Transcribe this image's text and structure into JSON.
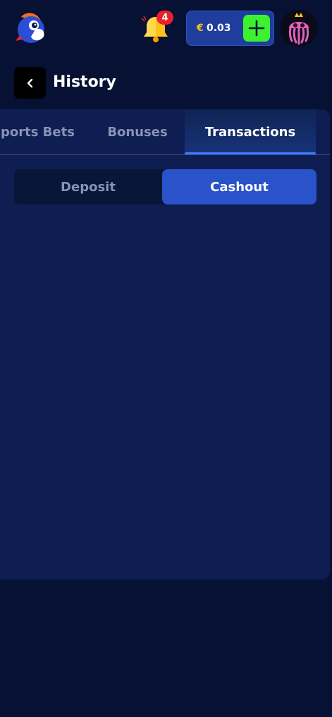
{
  "header": {
    "notification_count": "4",
    "currency_symbol": "€",
    "balance": "0.03"
  },
  "page": {
    "title": "History"
  },
  "tabs": [
    {
      "label": "Sports Bets"
    },
    {
      "label": "Bonuses"
    },
    {
      "label": "Transactions"
    }
  ],
  "active_tab": "Transactions",
  "segments": {
    "deposit": "Deposit",
    "cashout": "Cashout",
    "active": "Cashout"
  },
  "icons": {
    "logo": "bird-logo-icon",
    "bell": "bell-icon",
    "add": "plus-icon",
    "back": "chevron-left-icon",
    "avatar": "jellyfish-avatar"
  },
  "colors": {
    "background": "#061133",
    "panel": "#0e1e52",
    "accent": "#2a52c9",
    "add_button": "#3cf22f",
    "badge": "#e8212b",
    "currency": "#f5c518"
  }
}
